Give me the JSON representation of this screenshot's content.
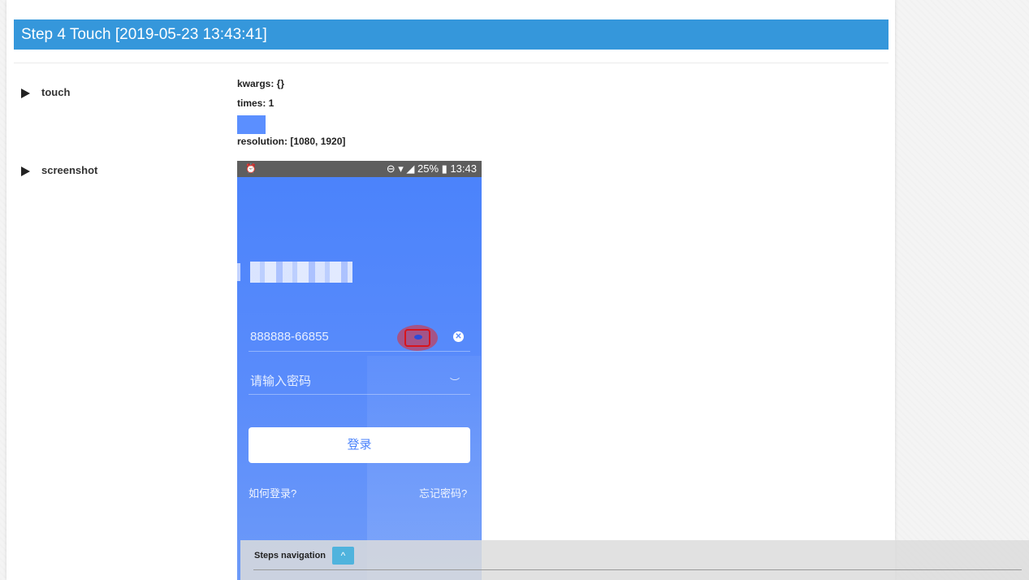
{
  "step": {
    "title": "Step 4 Touch [2019-05-23 13:43:41]"
  },
  "touch": {
    "label": "touch",
    "kwargs": "kwargs: {}",
    "times": "times: 1",
    "resolution": "resolution: [1080, 1920]"
  },
  "screenshot": {
    "label": "screenshot",
    "status_time": "13:43",
    "status_battery": "25%",
    "account_value": "888888-66855",
    "password_placeholder": "请输入密码",
    "login_label": "登录",
    "how_login": "如何登录?",
    "forgot": "忘记密码?"
  },
  "nav": {
    "label": "Steps navigation"
  },
  "colors": {
    "header": "#3597db",
    "phone_bg": "#4a82fb",
    "nav_button": "#4fb3dd",
    "highlight": "#d8141c"
  }
}
